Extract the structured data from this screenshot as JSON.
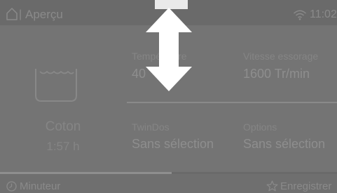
{
  "header": {
    "separator": "|",
    "title": "Aperçu",
    "time": "11:02"
  },
  "program": {
    "name": "Coton",
    "duration": "1:57  h"
  },
  "parameters": [
    {
      "label": "Température",
      "value": "40 °C"
    },
    {
      "label": "Vitesse essorage",
      "value": "1600 Tr/min"
    },
    {
      "label": "TwinDos",
      "value": "Sans sélection"
    },
    {
      "label": "Options",
      "value": "Sans sélection"
    }
  ],
  "progress": {
    "fraction": 0.51
  },
  "footer": {
    "timer_label": "Minuteur",
    "save_label": "Enregistrer"
  },
  "icons": {
    "home": "home-icon",
    "wifi": "wifi-icon",
    "tub": "wash-tub-icon",
    "timer": "clock-icon",
    "star": "star-icon",
    "scroll_hint": "double-arrow-vertical-icon"
  },
  "colors": {
    "overlay_arrow": "#ffffff",
    "screen_dimmed": "#747474"
  }
}
